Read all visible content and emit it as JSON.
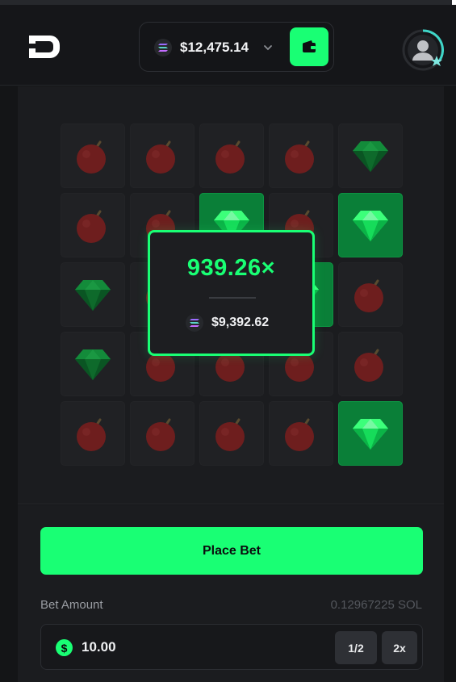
{
  "header": {
    "balance": "$12,475.14",
    "currency_icon": "solana-icon",
    "wallet_icon": "wallet-icon",
    "accent_color": "#19ff74"
  },
  "board": {
    "rows": 5,
    "cols": 5,
    "tiles": [
      "bomb",
      "bomb",
      "bomb",
      "bomb",
      "gem-dim",
      "bomb",
      "bomb",
      "gem",
      "bomb",
      "gem",
      "gem-dim",
      "bomb",
      "bomb",
      "gem",
      "bomb",
      "gem-dim",
      "bomb",
      "bomb",
      "bomb",
      "bomb",
      "bomb",
      "bomb",
      "bomb",
      "bomb",
      "gem"
    ]
  },
  "result": {
    "multiplier": "939.26×",
    "payout": "$9,392.62"
  },
  "controls": {
    "place_bet_label": "Place Bet",
    "bet_amount_label": "Bet Amount",
    "sol_equivalent": "0.12967225 SOL",
    "bet_value": "10.00",
    "half_label": "1/2",
    "double_label": "2x"
  }
}
